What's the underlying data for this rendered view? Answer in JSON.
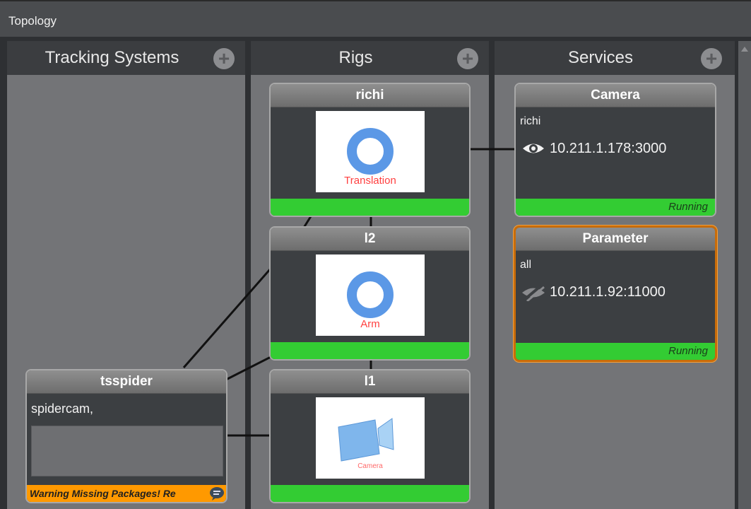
{
  "window": {
    "title": "Topology"
  },
  "columns": [
    {
      "label": "Tracking Systems"
    },
    {
      "label": "Rigs"
    },
    {
      "label": "Services"
    }
  ],
  "rigs": [
    {
      "name": "richi",
      "image_label": "Translation",
      "icon": "ring-icon"
    },
    {
      "name": "l2",
      "image_label": "Arm",
      "icon": "ring-icon"
    },
    {
      "name": "l1",
      "image_label": "Camera",
      "icon": "camera-icon"
    }
  ],
  "services": [
    {
      "name": "Camera",
      "rig": "richi",
      "address": "10.211.1.178:3000",
      "status": "Running",
      "icon": "eye-icon"
    },
    {
      "name": "Parameter",
      "rig": "all",
      "address": "10.211.1.92:11000",
      "status": "Running",
      "icon": "eye-hidden-icon"
    }
  ],
  "tracking_systems": [
    {
      "name": "tsspider",
      "description": "spidercam,",
      "warning": "Warning Missing Packages! Re"
    }
  ],
  "colors": {
    "running": "#33cc33",
    "warning": "#ff9900",
    "selected_border": "#c86c0a"
  }
}
